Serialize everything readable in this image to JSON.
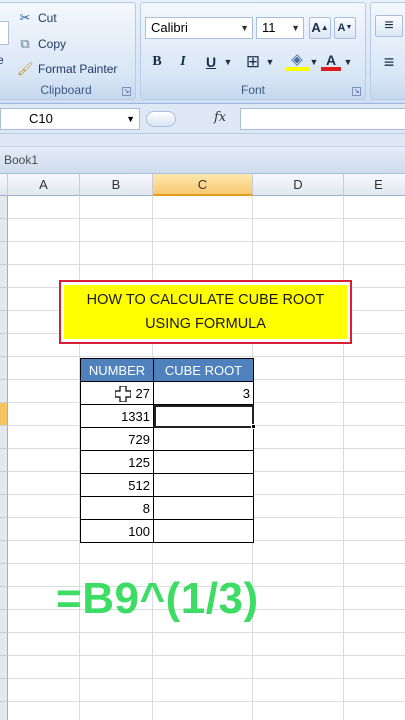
{
  "ribbon": {
    "clipboard": {
      "cut": "Cut",
      "copy": "Copy",
      "format_painter": "Format Painter",
      "label": "Clipboard",
      "paste_partial": "e"
    },
    "font": {
      "font_name": "Calibri",
      "font_size": "11",
      "bold": "B",
      "italic": "I",
      "underline": "U",
      "grow": "A",
      "shrink": "A",
      "font_color_letter": "A",
      "label": "Font"
    }
  },
  "formula_bar": {
    "name_box": "C10",
    "fx_label": "fx",
    "formula": ""
  },
  "workbook": {
    "title": "Book1"
  },
  "sheet": {
    "columns": [
      "A",
      "B",
      "C",
      "D",
      "E"
    ],
    "selected_column": "C",
    "title_box": {
      "line1": "HOW TO CALCULATE CUBE ROOT",
      "line2": "USING FORMULA",
      "fill": "#ffff00",
      "border": "#d51f36"
    },
    "table": {
      "headers": [
        "NUMBER",
        "CUBE ROOT"
      ],
      "header_fill": "#4f81bd",
      "rows": [
        [
          "27",
          "3"
        ],
        [
          "1331",
          ""
        ],
        [
          "729",
          ""
        ],
        [
          "125",
          ""
        ],
        [
          "512",
          ""
        ],
        [
          "8",
          ""
        ],
        [
          "100",
          ""
        ]
      ]
    }
  },
  "overlay_formula": "=B9^(1/3)",
  "colors": {
    "overlay": "#3ddc64",
    "ribbon_text": "#1e3a66"
  }
}
